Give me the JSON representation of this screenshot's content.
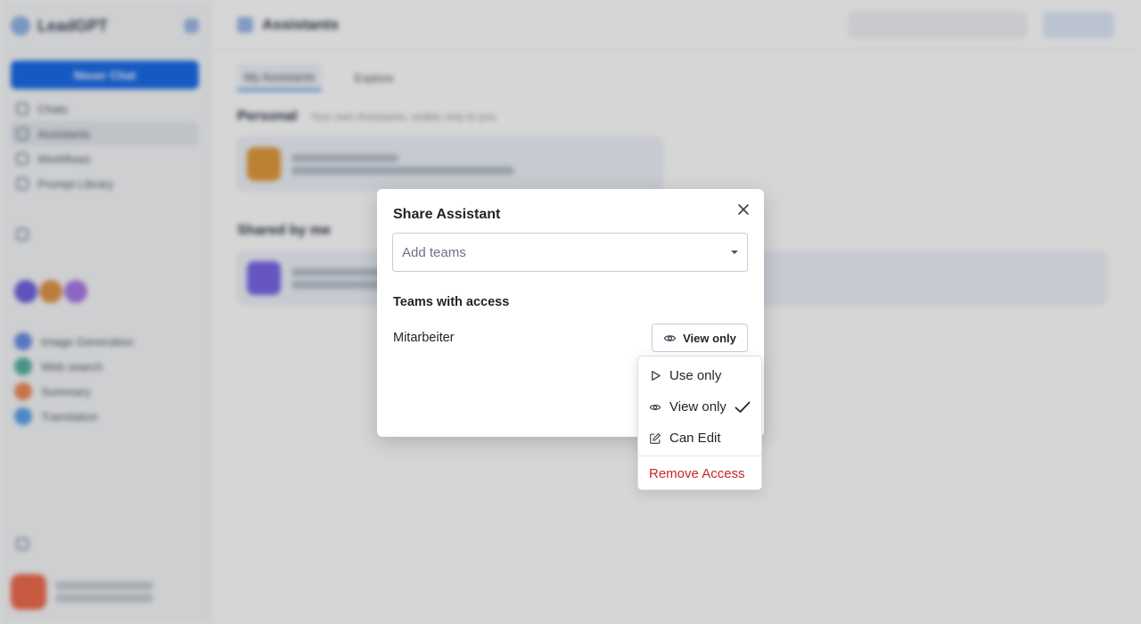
{
  "background": {
    "app_name": "LeadGPT",
    "new_chat_label": "Neuer Chat",
    "nav_items": [
      "Chats",
      "Assistants",
      "Workflows",
      "Prompt Library"
    ],
    "page_title": "Assistants",
    "tabs": [
      "My Assistants",
      "Explore"
    ],
    "section_personal": "Personal",
    "section_personal_sub": "Your own Assistants, visible only to you",
    "section_shared": "Shared by me",
    "recent_items": [
      "Image Generation",
      "Web search",
      "Summary",
      "Translation"
    ]
  },
  "modal": {
    "title": "Share Assistant",
    "teams_placeholder": "Add teams",
    "access_heading": "Teams with access",
    "team_name": "Mitarbeiter",
    "permission_label": "View only"
  },
  "menu": {
    "items": [
      {
        "label": "Use only",
        "icon": "play-icon",
        "selected": false
      },
      {
        "label": "View only",
        "icon": "eye-icon",
        "selected": true
      },
      {
        "label": "Can Edit",
        "icon": "edit-icon",
        "selected": false
      }
    ],
    "remove_label": "Remove Access",
    "danger_color": "#c62828"
  },
  "colors": {
    "accent": "#1a6ce8"
  }
}
